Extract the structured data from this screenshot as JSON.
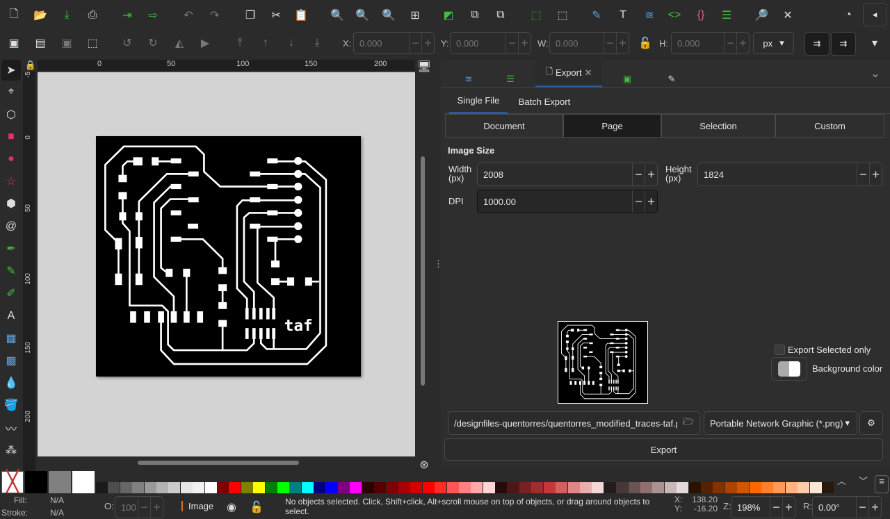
{
  "toolbar_commands": [
    "new-document",
    "open",
    "save",
    "print",
    "import",
    "export",
    "undo",
    "redo",
    "duplicate",
    "cut",
    "paste",
    "zoom-selection",
    "zoom-drawing",
    "zoom-page",
    "zoom-center",
    "raise-to-top",
    "lock",
    "unlock",
    "group",
    "ungroup",
    "fill-stroke",
    "text",
    "layers",
    "xml-editor",
    "selectors",
    "align",
    "find",
    "preferences"
  ],
  "select_toolbar": {
    "x_label": "X:",
    "x": "0.000",
    "y_label": "Y:",
    "y": "0.000",
    "w_label": "W:",
    "w": "0.000",
    "h_label": "H:",
    "h": "0.000",
    "unit": "px"
  },
  "ruler": {
    "top": [
      "0",
      "50",
      "100",
      "150",
      "200"
    ],
    "left": [
      "-5",
      "0",
      "50",
      "100",
      "150",
      "200"
    ]
  },
  "canvas": {
    "label": "taf"
  },
  "panel": {
    "tabs": [
      {
        "icon": "layers-icon"
      },
      {
        "icon": "align-icon"
      },
      {
        "label": "Export"
      },
      {
        "icon": "image-icon"
      },
      {
        "icon": "fill-stroke-icon"
      }
    ],
    "subtabs": [
      "Single File",
      "Batch Export"
    ],
    "areas": [
      "Document",
      "Page",
      "Selection",
      "Custom"
    ],
    "active_area": "Page",
    "image_size_title": "Image Size",
    "width_label": "Width\n(px)",
    "width": "2008",
    "height_label": "Height\n(px)",
    "height": "1824",
    "dpi_label": "DPI",
    "dpi": "1000.00",
    "export_selected_only": "Export Selected only",
    "background_color": "Background color",
    "filename": "/designfiles-quentorres/quentorres_modified_traces-taf.png",
    "format": "Portable Network Graphic (*.png)",
    "export_button": "Export"
  },
  "palette": [
    "#1a1a1a",
    "#4d4d4d",
    "#666666",
    "#808080",
    "#999999",
    "#b3b3b3",
    "#cccccc",
    "#e6e6e6",
    "#f2f2f2",
    "#ffffff",
    "#800000",
    "#ff0000",
    "#808000",
    "#ffff00",
    "#008000",
    "#00ff00",
    "#008080",
    "#00ffff",
    "#000080",
    "#0000ff",
    "#800080",
    "#ff00ff",
    "#2b0000",
    "#550000",
    "#800000",
    "#aa0000",
    "#d40000",
    "#ff0000",
    "#ff2a2a",
    "#ff5555",
    "#ff8080",
    "#ffaaaa",
    "#ffd5d5",
    "#280b0b",
    "#501616",
    "#782121",
    "#a02c2c",
    "#c83737",
    "#d35f5f",
    "#de8787",
    "#e9afaf",
    "#f4d7d7",
    "#241c1c",
    "#483737",
    "#6c5353",
    "#916f6f",
    "#ac9393",
    "#c8b7b7",
    "#e3dbdb",
    "#2b1100",
    "#552200",
    "#803300",
    "#aa4400",
    "#d45500",
    "#ff6600",
    "#ff7f2a",
    "#ff9955",
    "#ffb380",
    "#ffccaa",
    "#ffe6d5",
    "#28170b"
  ],
  "status": {
    "fill_label": "Fill:",
    "fill": "N/A",
    "stroke_label": "Stroke:",
    "stroke": "N/A",
    "opacity_label": "O:",
    "opacity": "100",
    "layer": "Image",
    "message": "No objects selected. Click, Shift+click, Alt+scroll mouse on top of objects, or drag around objects to select.",
    "x_label": "X:",
    "x": "138.20",
    "y_label": "Y:",
    "y": "-16.20",
    "zoom_label": "Z:",
    "zoom": "198%",
    "rotation_label": "R:",
    "rotation": "0.00°"
  }
}
